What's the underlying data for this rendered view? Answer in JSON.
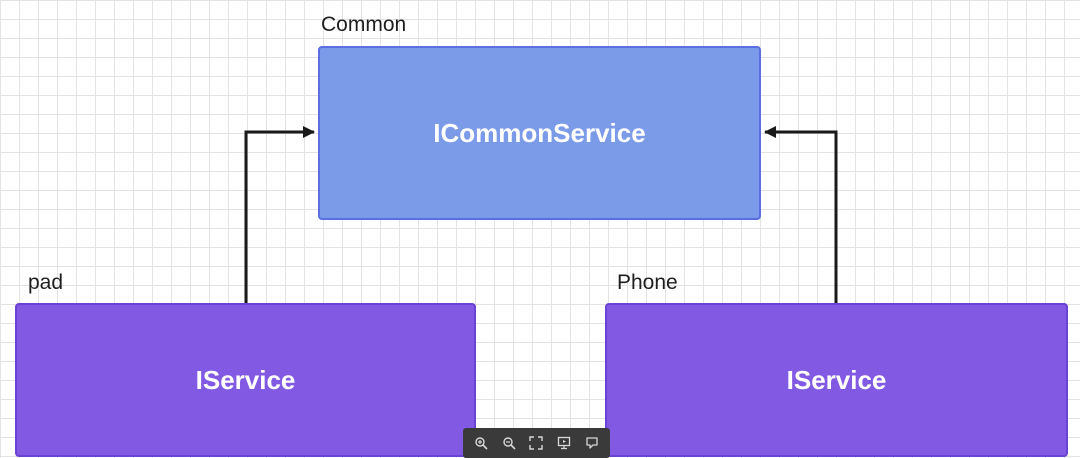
{
  "groups": {
    "common_label": "Common",
    "pad_label": "pad",
    "phone_label": "Phone"
  },
  "nodes": {
    "common": {
      "label": "ICommonService",
      "fill": "#7b9ae8",
      "stroke": "#5b6fe0"
    },
    "pad": {
      "label": "IService",
      "fill": "#8259e2",
      "stroke": "#6a43d6"
    },
    "phone": {
      "label": "IService",
      "fill": "#8259e2",
      "stroke": "#6a43d6"
    }
  },
  "edges": [
    {
      "from": "pad",
      "to": "common"
    },
    {
      "from": "phone",
      "to": "common"
    }
  ],
  "toolbar": {
    "tools": [
      {
        "icon": "zoom-in-icon"
      },
      {
        "icon": "zoom-out-icon"
      },
      {
        "icon": "fit-screen-icon"
      },
      {
        "icon": "presentation-icon"
      },
      {
        "icon": "comment-icon"
      }
    ]
  },
  "colors": {
    "edge": "#1a1a1a",
    "grid": "#e3e3e3",
    "toolbar_bg": "#3a3a3a"
  }
}
